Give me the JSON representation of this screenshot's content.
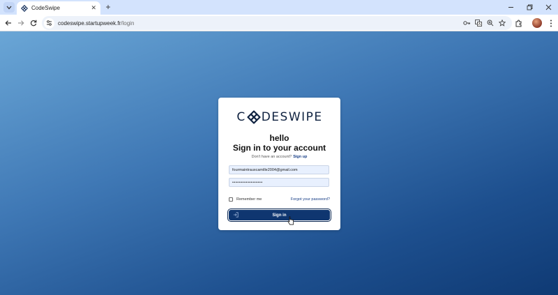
{
  "browser": {
    "tab_title": "CodeSwipe",
    "url_domain": "codeswipe.startupweek.fr",
    "url_path": "/login"
  },
  "login": {
    "logo_text_left": "C",
    "logo_text_right": "DESWIPE",
    "greeting": "hello",
    "title": "Sign in to your account",
    "no_account_text": "Don't have an account?",
    "signup_link": "Sign up",
    "email_value": "fourmaintrauxcamille2004@gmail.com",
    "password_value": "••••••••••••••••••",
    "remember_label": "Remember me",
    "forgot_link": "Forgot your password?",
    "signin_button": "Sign in"
  },
  "colors": {
    "brand_dark": "#0f3670",
    "link": "#173e86",
    "background_gradient_start": "#6aa6d6",
    "background_gradient_end": "#0f3a74"
  },
  "icons": [
    "tab-search-icon",
    "codeswipe-favicon-icon",
    "close-icon",
    "plus-icon",
    "minimize-icon",
    "restore-icon",
    "back-icon",
    "forward-icon",
    "reload-icon",
    "site-info-icon",
    "password-key-icon",
    "translate-icon",
    "zoom-icon",
    "bookmark-star-icon",
    "extensions-icon",
    "menu-icon",
    "login-arrow-icon"
  ]
}
